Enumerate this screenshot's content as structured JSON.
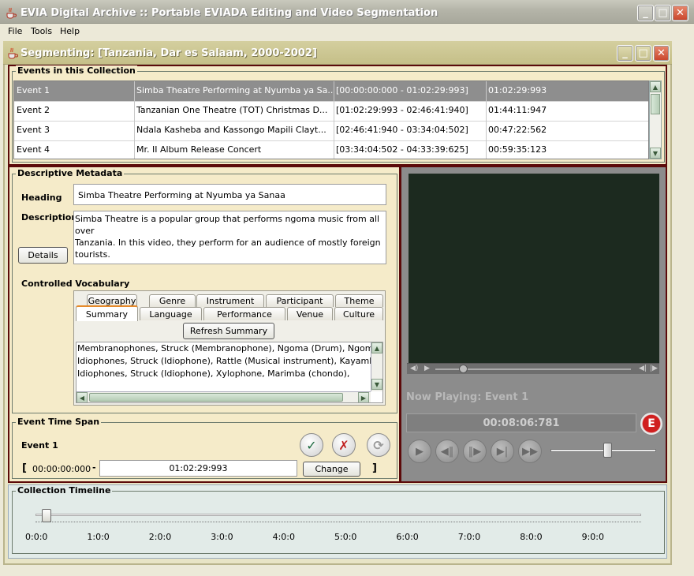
{
  "window": {
    "title": "EVIA Digital Archive :: Portable EVIADA Editing and Video Segmentation"
  },
  "menu": [
    {
      "label": "File"
    },
    {
      "label": "Tools"
    },
    {
      "label": "Help"
    }
  ],
  "frame": {
    "title": "Segmenting: [Tanzania, Dar es Salaam, 2000-2002]"
  },
  "events_panel": {
    "label": "Events in this Collection",
    "rows": [
      {
        "name": "Event 1",
        "title": "Simba Theatre Performing at Nyumba ya Sa...",
        "range": "[00:00:00:000 - 01:02:29:993]",
        "duration": "01:02:29:993",
        "selected": true
      },
      {
        "name": "Event 2",
        "title": "Tanzanian One Theatre (TOT) Christmas D...",
        "range": "[01:02:29:993 - 02:46:41:940]",
        "duration": "01:44:11:947",
        "selected": false
      },
      {
        "name": "Event 3",
        "title": "Ndala Kasheba and Kassongo Mapili Clayt...",
        "range": "[02:46:41:940 - 03:34:04:502]",
        "duration": "00:47:22:562",
        "selected": false
      },
      {
        "name": "Event 4",
        "title": "Mr. II Album Release Concert",
        "range": "[03:34:04:502 - 04:33:39:625]",
        "duration": "00:59:35:123",
        "selected": false
      }
    ]
  },
  "metadata": {
    "label": "Descriptive Metadata",
    "heading_label": "Heading",
    "heading_value": "Simba Theatre Performing at Nyumba ya Sanaa",
    "description_label": "Description",
    "description_line1": "Simba Theatre is a popular group that performs ngoma music from all over",
    "description_line2": "Tanzania. In this video, they perform for an audience of mostly foreign tourists.",
    "details_button": "Details",
    "vocab_label": "Controlled Vocabulary",
    "tabs_back": [
      "Geography",
      "Genre",
      "Instrument",
      "Participant",
      "Theme"
    ],
    "tabs_front": [
      "Summary",
      "Language",
      "Performance",
      "Venue",
      "Culture"
    ],
    "active_tab": "Summary",
    "refresh_button": "Refresh Summary",
    "summary_lines": [
      "Membranophones, Struck (Membranophone), Ngoma (Drum), Ngom",
      "Idiophones, Struck (Idiophone), Rattle (Musical instrument), Kayamb",
      "Idiophones, Struck (Idiophone), Xylophone, Marimba (chondo),"
    ]
  },
  "player": {
    "now_playing": "Now Playing: Event 1",
    "time": "00:08:06:781",
    "seek_fraction": 0.12,
    "volume_fraction": 0.5
  },
  "time_span": {
    "label": "Event Time Span",
    "event_name": "Event 1",
    "open_bracket": "[",
    "start": "00:00:00:000",
    "dash": "-",
    "end": "01:02:29:993",
    "close_bracket": "]",
    "change_button": "Change"
  },
  "timeline": {
    "label": "Collection Timeline",
    "ticks": [
      "0:0:0",
      "1:0:0",
      "2:0:0",
      "3:0:0",
      "4:0:0",
      "5:0:0",
      "6:0:0",
      "7:0:0",
      "8:0:0",
      "9:0:0"
    ],
    "thumb_value": 0.1
  },
  "colors": {
    "panel_border": "#5c0a0a",
    "panel_bg": "#f5ebc9",
    "selected_row": "#8e8e8e",
    "video_bg": "#1c2a1f"
  }
}
